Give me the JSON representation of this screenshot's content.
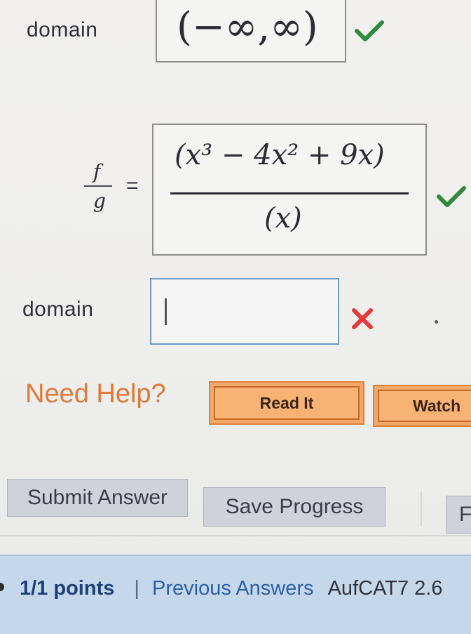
{
  "row1": {
    "label": "domain",
    "answer": "(−∞,∞)"
  },
  "row2": {
    "fraction_label_top": "f",
    "fraction_label_bottom": "g",
    "equals": "=",
    "numerator": "(x³ − 4x² + 9x)",
    "denominator": "(x)"
  },
  "row3": {
    "label": "domain",
    "input_value": "",
    "status": "incorrect"
  },
  "help": {
    "label": "Need Help?",
    "read_button": "Read It",
    "watch_button": "Watch"
  },
  "actions": {
    "submit": "Submit Answer",
    "save": "Save Progress",
    "partial": "F"
  },
  "footer": {
    "points": "1/1 points",
    "separator": "|",
    "previous": "Previous Answers",
    "course_code": "AufCAT7 2.6"
  },
  "colors": {
    "check_green": "#2f8a3b",
    "x_red": "#e23b3b",
    "help_orange": "#e07a3a"
  }
}
